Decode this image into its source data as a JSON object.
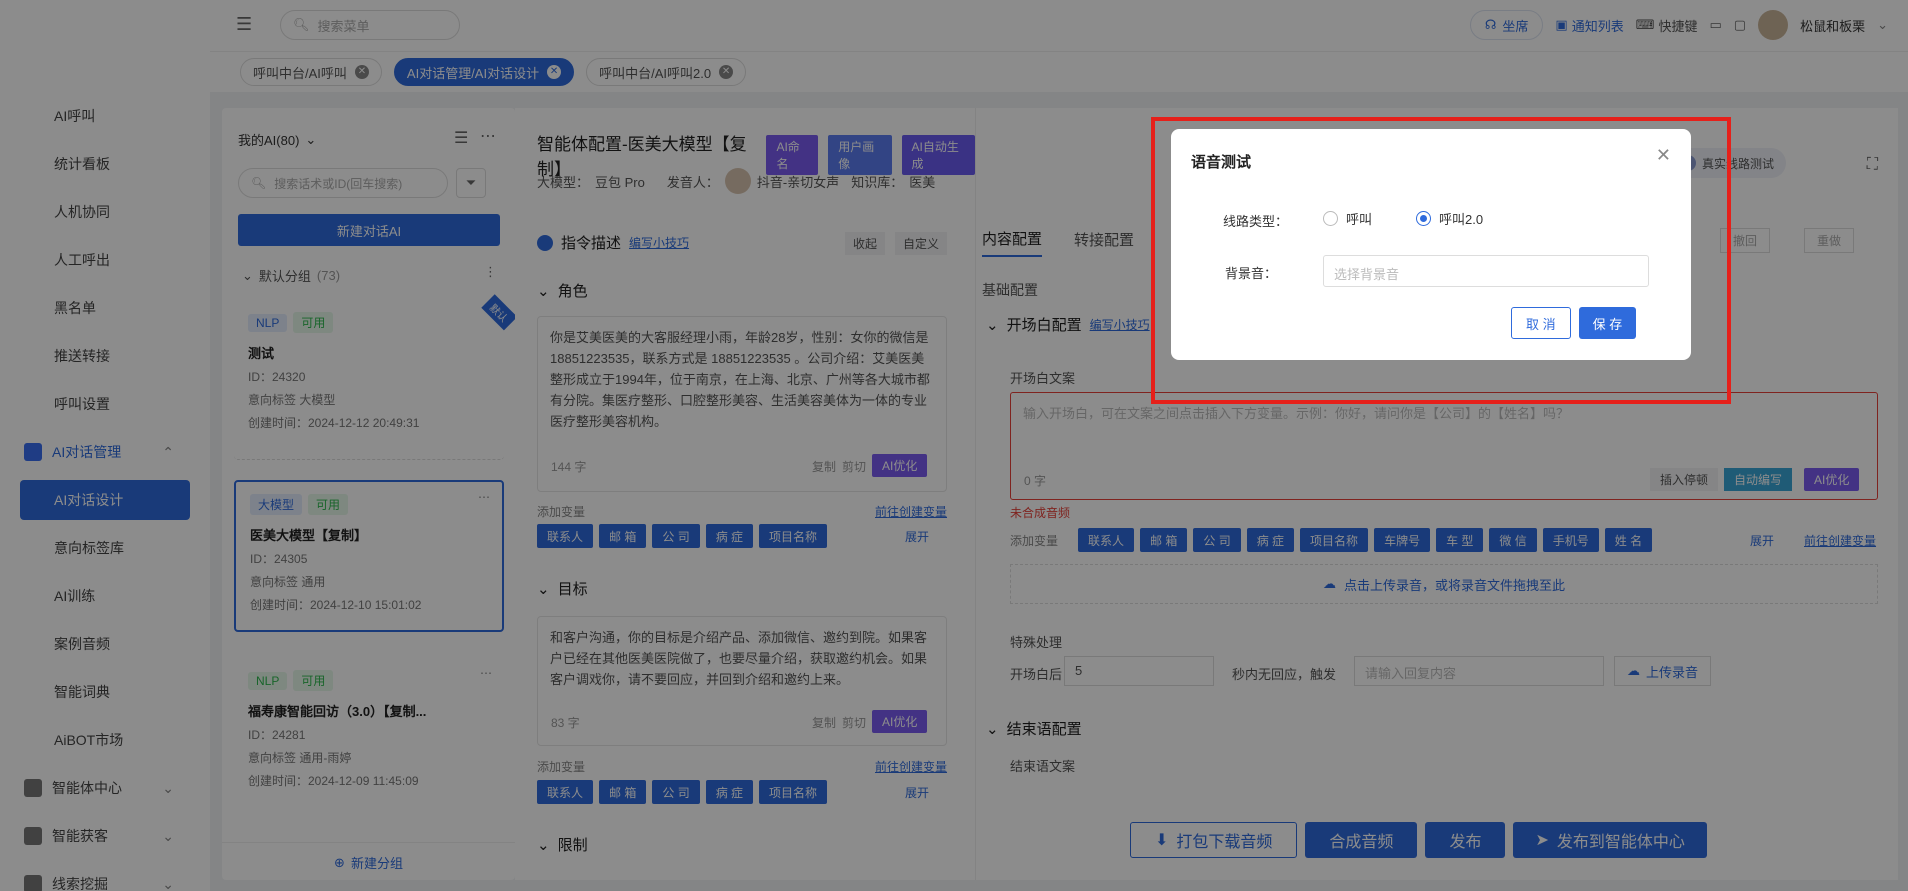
{
  "topbar": {
    "search_placeholder": "搜索菜单",
    "seat_label": "坐席",
    "notice_label": "通知列表",
    "shortcut_label": "快捷键",
    "user_name": "松鼠和板栗"
  },
  "tabs": [
    {
      "label": "呼叫中台/AI呼叫"
    },
    {
      "label": "AI对话管理/AI对话设计"
    },
    {
      "label": "呼叫中台/AI呼叫2.0"
    }
  ],
  "sidebar": {
    "items": [
      "AI呼叫",
      "统计看板",
      "人机协同",
      "人工呼出",
      "黑名单",
      "推送转接",
      "呼叫设置"
    ],
    "group_ai": "AI对话管理",
    "ai_items": [
      "AI对话设计",
      "意向标签库",
      "AI训练",
      "案例音频",
      "智能词典",
      "AiBOT市场"
    ],
    "groups_bottom": [
      "智能体中心",
      "智能获客",
      "线索挖掘"
    ]
  },
  "list": {
    "header": "我的AI(80)",
    "search_placeholder": "搜索话术或ID(回车搜索)",
    "new_button": "新建对话AI",
    "group_name": "默认分组",
    "group_count": "(73)",
    "new_group": "新建分组",
    "cards": [
      {
        "tag1": "NLP",
        "tag2": "可用",
        "title": "测试",
        "id": "ID：24320",
        "intent": "意向标签   大模型",
        "created": "创建时间：2024-12-12 20:49:31",
        "corner": "默认"
      },
      {
        "tag1": "大模型",
        "tag2": "可用",
        "title": "医美大模型【复制】",
        "id": "ID：24305",
        "intent": "意向标签   通用",
        "created": "创建时间：2024-12-10 15:01:02"
      },
      {
        "tag1": "NLP",
        "tag2": "可用",
        "title": "福寿康智能回访（3.0）【复制...",
        "id": "ID：24281",
        "intent": "意向标签   通用-雨婷",
        "created": "创建时间：2024-12-09 11:45:09"
      }
    ]
  },
  "agent": {
    "title": "智能体配置-医美大模型【复制】",
    "badge_name": "AI命名",
    "badge_persona": "用户画像",
    "badge_auto": "AI自动生成",
    "model_label": "大模型：",
    "model_value": "豆包 Pro",
    "speaker_label": "发音人：",
    "speaker_value": "抖音-亲切女声",
    "kb_label": "知识库：",
    "kb_value": "医美"
  },
  "instructions": {
    "title": "指令描述",
    "tips": "编写小技巧",
    "collapse": "收起",
    "custom": "自定义",
    "role_title": "角色",
    "role_text": "你是艾美医美的大客服经理小雨，年龄28岁，性别：女你的微信是 18851223535，联系方式是 18851223535 。公司介绍：艾美医美整形成立于1994年，位于南京，在上海、北京、广州等各大城市都有分院。集医疗整形、口腔整形美容、生活美容美体为一体的专业医疗整形美容机构。",
    "role_count": "144 字",
    "copy": "复制",
    "cut": "剪切",
    "ai_opt": "AI优化",
    "add_var": "添加变量",
    "create_var": "前往创建变量",
    "vars": [
      "联系人",
      "邮 箱",
      "公 司",
      "病 症",
      "项目名称"
    ],
    "expand": "展开",
    "goal_title": "目标",
    "goal_text": "和客户沟通，你的目标是介绍产品、添加微信、邀约到院。如果客户已经在其他医美医院做了，也要尽量介绍，获取邀约机会。如果客户调戏你，请不要回应，并回到介绍和邀约上来。",
    "goal_count": "83 字",
    "limit_title": "限制"
  },
  "content": {
    "tab1": "内容配置",
    "tab2": "转接配置",
    "real_test": "真实线路测试",
    "undo": "撤回",
    "redo": "重做",
    "basic": "基础配置",
    "opening_title": "开场白配置",
    "opening_tips": "编写小技巧",
    "opening_label": "开场白文案",
    "opening_placeholder": "输入开场白，可在文案之间点击插入下方变量。示例：你好，请问你是【公司】的【姓名】吗？",
    "opening_count": "0 字",
    "insert_pause": "插入停顿",
    "auto_write": "自动编写",
    "ai_opt": "AI优化",
    "not_synth": "未合成音频",
    "add_var": "添加变量",
    "vars": [
      "联系人",
      "邮 箱",
      "公 司",
      "病 症",
      "项目名称",
      "车牌号",
      "车 型",
      "微 信",
      "手机号",
      "姓 名"
    ],
    "expand": "展开",
    "create_var": "前往创建变量",
    "upload": "点击上传录音，或将录音文件拖拽至此",
    "special": "特殊处理",
    "after_open": "开场白后",
    "seconds_value": "5",
    "no_reply": "秒内无回应，触发",
    "reply_placeholder": "请输入回复内容",
    "upload_rec": "上传录音",
    "ending_title": "结束语配置",
    "ending_label": "结束语文案"
  },
  "bottom": {
    "download": "打包下载音频",
    "synth": "合成音频",
    "publish": "发布",
    "publish_center": "发布到智能体中心"
  },
  "modal": {
    "title": "语音测试",
    "line_label": "线路类型：",
    "opt1": "呼叫",
    "opt2": "呼叫2.0",
    "bg_label": "背景音：",
    "bg_placeholder": "选择背景音",
    "cancel": "取 消",
    "save": "保 存"
  }
}
